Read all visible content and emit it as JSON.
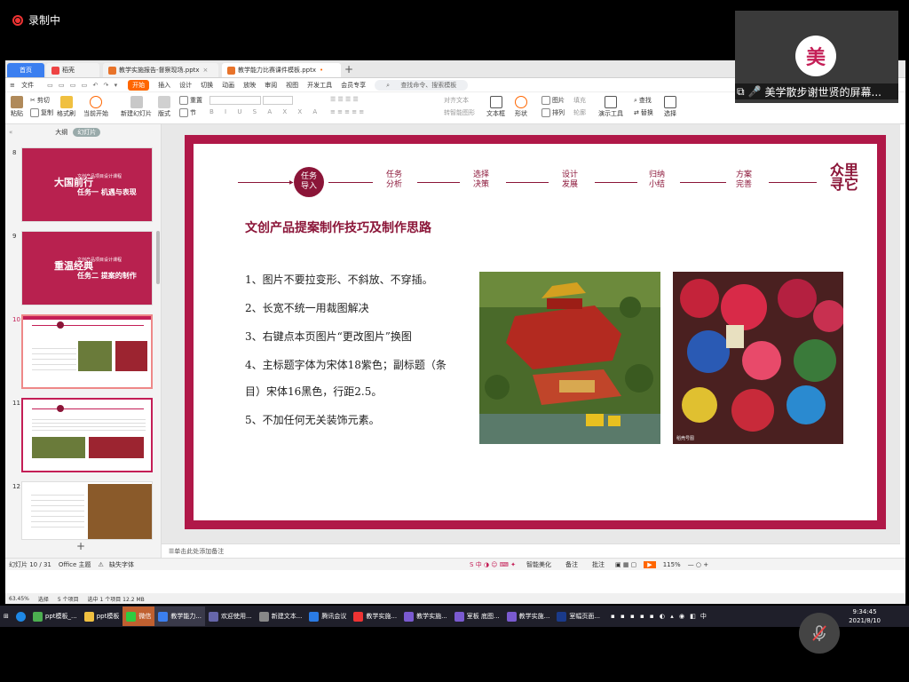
{
  "recording": {
    "label": "录制中"
  },
  "tabs": {
    "home": "首页",
    "t2": "稻壳",
    "t3": "教学实施报告-督察现场.pptx",
    "t4": "教学能力比赛课件模板.pptx"
  },
  "menu": {
    "file": "文件",
    "items": [
      "开始",
      "插入",
      "设计",
      "切换",
      "动画",
      "放映",
      "审阅",
      "视图",
      "开发工具",
      "会员专享"
    ],
    "search": "查找命令、搜索模板"
  },
  "ribbon": {
    "cut": "剪切",
    "copy": "复制",
    "paste": "粘贴",
    "format_painter": "格式刷",
    "from_current": "当前开始",
    "new_slide": "新建幻灯片",
    "layout": "版式",
    "section": "节",
    "reset": "重置",
    "align_text": "对齐文本",
    "textbox": "文本框",
    "shape": "形状",
    "picture": "图片",
    "arrange": "排列",
    "fill": "填充",
    "outline": "轮廓",
    "presentation_tools": "演示工具",
    "find": "查找",
    "replace": "替换",
    "select": "选择",
    "smartart": "转智能图形"
  },
  "pane": {
    "outline": "大纲",
    "slides": "幻灯片"
  },
  "thumbs": [
    {
      "num": "8",
      "title": "大国前行",
      "sub": "文创产品项目设计课程",
      "body": "任务一 机遇与表现"
    },
    {
      "num": "9",
      "title": "重温经典",
      "sub": "文创产品项目设计课程",
      "body": "任务二 提案的制作"
    },
    {
      "num": "10"
    },
    {
      "num": "11"
    },
    {
      "num": "12"
    }
  ],
  "slide": {
    "steps": [
      "任务导入",
      "任务分析",
      "选择决策",
      "设计发展",
      "归纳小结",
      "方案完善"
    ],
    "title": "文创产品提案制作技巧及制作思路",
    "bullets": [
      "1、图片不要拉变形、不斜放、不穿插。",
      "2、长宽不统一用裁图解决",
      "3、右键点本页图片“更改图片”换图",
      "4、主标题字体为宋体18紫色；副标题（条",
      "目）宋体16黑色，行距2.5。",
      "5、不加任何无关装饰元素。"
    ],
    "logo": "众里寻它",
    "photo2_caption": "稻壳号图"
  },
  "notes": {
    "placeholder": "单击此处添加备注"
  },
  "status": {
    "slide": "幻灯片 10 / 31",
    "theme": "Office 主题",
    "font": "缺失字体",
    "smart": "智能美化",
    "notes": "备注",
    "comments": "批注",
    "zoom": "115%"
  },
  "bgstatus": {
    "items": "5 个项目",
    "selected": "选中 1 个项目  12.2 MB",
    "zoom": "63.45%",
    "select": "选择"
  },
  "taskbar": {
    "apps": [
      "ppt模板_...",
      "ppt模板",
      "微信",
      "教学能力...",
      "欢迎使用...",
      "新建文本...",
      "腾讯会议",
      "教学实施...",
      "教学实施...",
      "室板 底图...",
      "教学实施...",
      "室幅页面..."
    ],
    "time": "9:34:45",
    "date": "2021/8/10",
    "lang": "中"
  },
  "video": {
    "name": "美学散步谢世贤的屏幕...",
    "avatar_glyph": "美"
  }
}
